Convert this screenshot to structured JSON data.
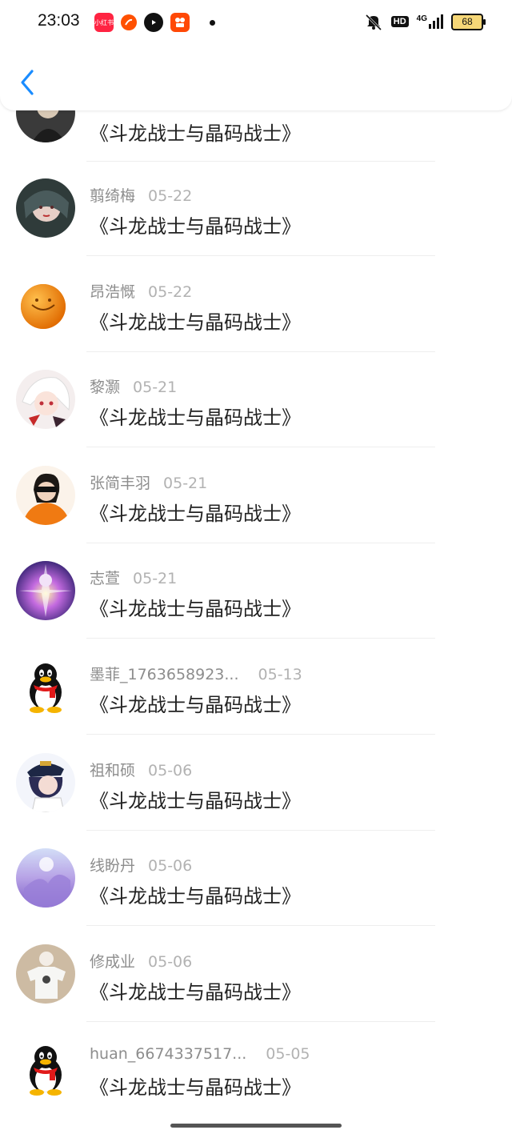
{
  "status_bar": {
    "time": "23:03",
    "apps": [
      {
        "icon": "xiaohongshu-icon",
        "label": "小红书",
        "color": "#ff2442"
      },
      {
        "icon": "taobao-icon",
        "label": "",
        "color": "#ff5000"
      },
      {
        "icon": "video-icon",
        "label": "",
        "color": "#111111"
      },
      {
        "icon": "kuaishou-icon",
        "label": "",
        "color": "#ff4906"
      }
    ],
    "hd": "HD",
    "network": "4G",
    "battery": "68"
  },
  "header": {
    "back_icon": "chevron-left-icon",
    "accent": "#1a8cff"
  },
  "rows": [
    {
      "name": "",
      "date": "",
      "title": "《斗龙战士与晶码战士》",
      "avatar": "dark-portrait"
    },
    {
      "name": "翦绮梅",
      "date": "05-22",
      "title": "《斗龙战士与晶码战士》",
      "avatar": "anime-girl"
    },
    {
      "name": "昂浩慨",
      "date": "05-22",
      "title": "《斗龙战士与晶码战士》",
      "avatar": "orange"
    },
    {
      "name": "黎灏",
      "date": "05-21",
      "title": "《斗龙战士与晶码战士》",
      "avatar": "white-hair-anime"
    },
    {
      "name": "张简丰羽",
      "date": "05-21",
      "title": "《斗龙战士与晶码战士》",
      "avatar": "sunglasses-girl"
    },
    {
      "name": "志萱",
      "date": "05-21",
      "title": "《斗龙战士与晶码战士》",
      "avatar": "purple-fantasy"
    },
    {
      "name": "墨菲_1763658923...",
      "date": "05-13",
      "title": "《斗龙战士与晶码战士》",
      "avatar": "qq-penguin"
    },
    {
      "name": "祖和硕",
      "date": "05-06",
      "title": "《斗龙战士与晶码战士》",
      "avatar": "anime-captain"
    },
    {
      "name": "线盼丹",
      "date": "05-06",
      "title": "《斗龙战士与晶码战士》",
      "avatar": "lavender-art"
    },
    {
      "name": "修成业",
      "date": "05-06",
      "title": "《斗龙战士与晶码战士》",
      "avatar": "tshirt-person"
    },
    {
      "name": "huan_6674337517...",
      "date": "05-05",
      "title": "《斗龙战士与晶码战士》",
      "avatar": "qq-penguin"
    }
  ]
}
